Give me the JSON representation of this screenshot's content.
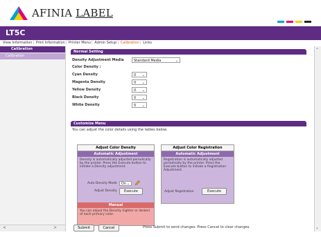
{
  "brand": {
    "name_part1": "AFINIA",
    "name_part2": "LABEL"
  },
  "app": {
    "title": "LT5C"
  },
  "nav": {
    "items": [
      "View Information",
      "Print Information",
      "Printer Menu",
      "Admin Setup",
      "Calibration",
      "Links"
    ],
    "active": "Calibration"
  },
  "sidebar": {
    "heading": "Calibration",
    "items": [
      "Calibration"
    ]
  },
  "normal_setting": {
    "heading": "Normal Setting",
    "media_label": "Density Adjustment Media",
    "media_value": "Standard Media",
    "color_density_label": "Color Density :",
    "rows": [
      {
        "label": "Cyan Density",
        "value": "0"
      },
      {
        "label": "Magenta Density",
        "value": "0"
      },
      {
        "label": "Yellow Density",
        "value": "0"
      },
      {
        "label": "Black Density",
        "value": "0"
      },
      {
        "label": "White Density",
        "value": "0"
      }
    ]
  },
  "customize": {
    "heading": "Customize Menu",
    "note": "You can adjust the color details using the tables below."
  },
  "density_panel": {
    "title": "Adjust Color Density",
    "auto_head": "Automatic Adjustment",
    "auto_text": "Density is automatically adjusted periodically by the printer. Press the Execute button to initiate a Density adjustment.",
    "mode_label": "Auto Density Mode",
    "mode_value": "On",
    "adjust_label": "Adjust Density",
    "execute": "Execute",
    "manual_head": "Manual",
    "manual_text": "You can adjust the Density (lighter or darker) of each primary color."
  },
  "registration_panel": {
    "title": "Adjust Color Registration",
    "auto_head": "Automatic Adjustment",
    "auto_text": "Registration is automatically adjusted periodically by the printer. Press the Execute button to initiate a Registration Adjustment.",
    "adjust_label": "Adjust Registration",
    "execute": "Execute"
  },
  "footer": {
    "submit": "Submit",
    "cancel": "Cancel",
    "message": "Press Submit to send changes. Press Cancel to clear changes."
  },
  "colors": {
    "primary": "#5e2c83",
    "accent": "#d06000",
    "manual": "#f3a8a8"
  }
}
